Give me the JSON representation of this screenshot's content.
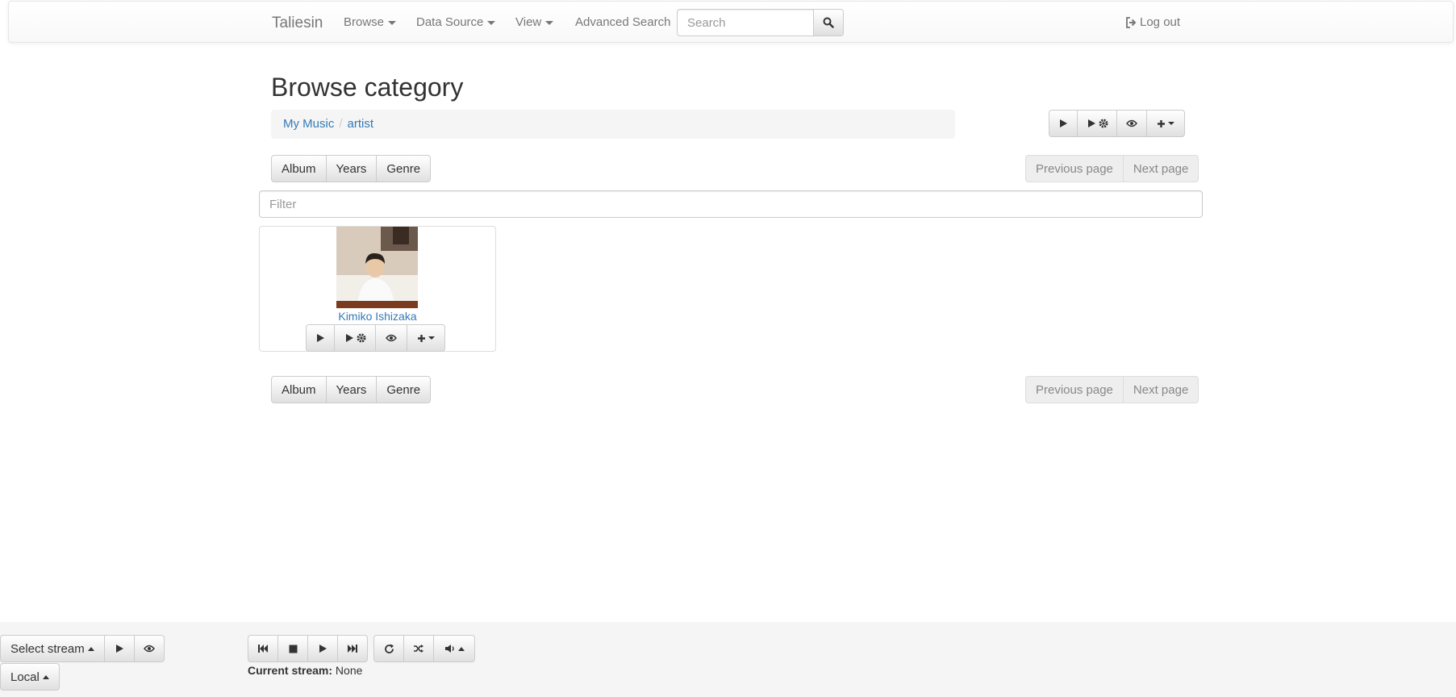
{
  "navbar": {
    "brand": "Taliesin",
    "browse": "Browse",
    "data_source": "Data Source",
    "view": "View",
    "advanced_search": "Advanced Search",
    "search_placeholder": "Search",
    "logout": "Log out"
  },
  "page": {
    "title": "Browse category",
    "breadcrumb": [
      "My Music",
      "artist"
    ]
  },
  "category_buttons": [
    "Album",
    "Years",
    "Genre"
  ],
  "pagination": {
    "previous": "Previous page",
    "next": "Next page"
  },
  "filter": {
    "placeholder": "Filter"
  },
  "items": [
    {
      "name": "Kimiko Ishizaka"
    }
  ],
  "footer": {
    "select_stream": "Select stream",
    "local": "Local",
    "current_stream_label": "Current stream:",
    "current_stream_value": "None"
  },
  "icons": {
    "search": "search-icon",
    "logout": "logout-icon",
    "play": "play-icon",
    "play_settings": "play-settings-icon",
    "eye": "eye-icon",
    "plus": "plus-icon",
    "previous_track": "previous-track-icon",
    "stop": "stop-icon",
    "next_track": "next-track-icon",
    "repeat": "repeat-icon",
    "shuffle": "shuffle-icon",
    "volume": "volume-icon"
  },
  "colors": {
    "link": "#337ab7",
    "navbar_text": "#777777",
    "footer_bg": "#f5f5f5"
  }
}
